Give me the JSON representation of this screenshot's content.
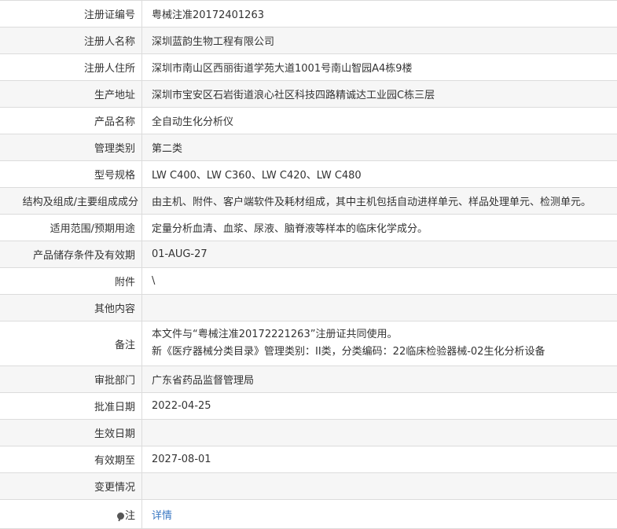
{
  "rows": [
    {
      "label": "注册证编号",
      "value": "粤械注准20172401263"
    },
    {
      "label": "注册人名称",
      "value": "深圳蓝韵生物工程有限公司"
    },
    {
      "label": "注册人住所",
      "value": "深圳市南山区西丽街道学苑大道1001号南山智园A4栋9楼"
    },
    {
      "label": "生产地址",
      "value": "深圳市宝安区石岩街道浪心社区科技四路精诚达工业园C栋三层"
    },
    {
      "label": "产品名称",
      "value": "全自动生化分析仪"
    },
    {
      "label": "管理类别",
      "value": "第二类"
    },
    {
      "label": "型号规格",
      "value": "LW C400、LW C360、LW C420、LW C480"
    },
    {
      "label": "结构及组成/主要组成成分",
      "value": "由主机、附件、客户端软件及耗材组成，其中主机包括自动进样单元、样品处理单元、检测单元。"
    },
    {
      "label": "适用范围/预期用途",
      "value": "定量分析血清、血浆、尿液、脑脊液等样本的临床化学成分。"
    },
    {
      "label": "产品储存条件及有效期",
      "value": "01-AUG-27"
    },
    {
      "label": "附件",
      "value": "\\"
    },
    {
      "label": "其他内容",
      "value": ""
    }
  ],
  "remark": {
    "label": "备注",
    "line1": "本文件与“粤械注准20172221263”注册证共同使用。",
    "line2": "新《医疗器械分类目录》管理类别：II类，分类编码：22临床检验器械-02生化分析设备"
  },
  "rows2": [
    {
      "label": "审批部门",
      "value": "广东省药品监督管理局"
    },
    {
      "label": "批准日期",
      "value": "2022-04-25"
    },
    {
      "label": "生效日期",
      "value": ""
    },
    {
      "label": "有效期至",
      "value": "2027-08-01"
    },
    {
      "label": "变更情况",
      "value": ""
    }
  ],
  "note": {
    "label": "注",
    "link": "详情",
    "icon": "pin-icon"
  }
}
